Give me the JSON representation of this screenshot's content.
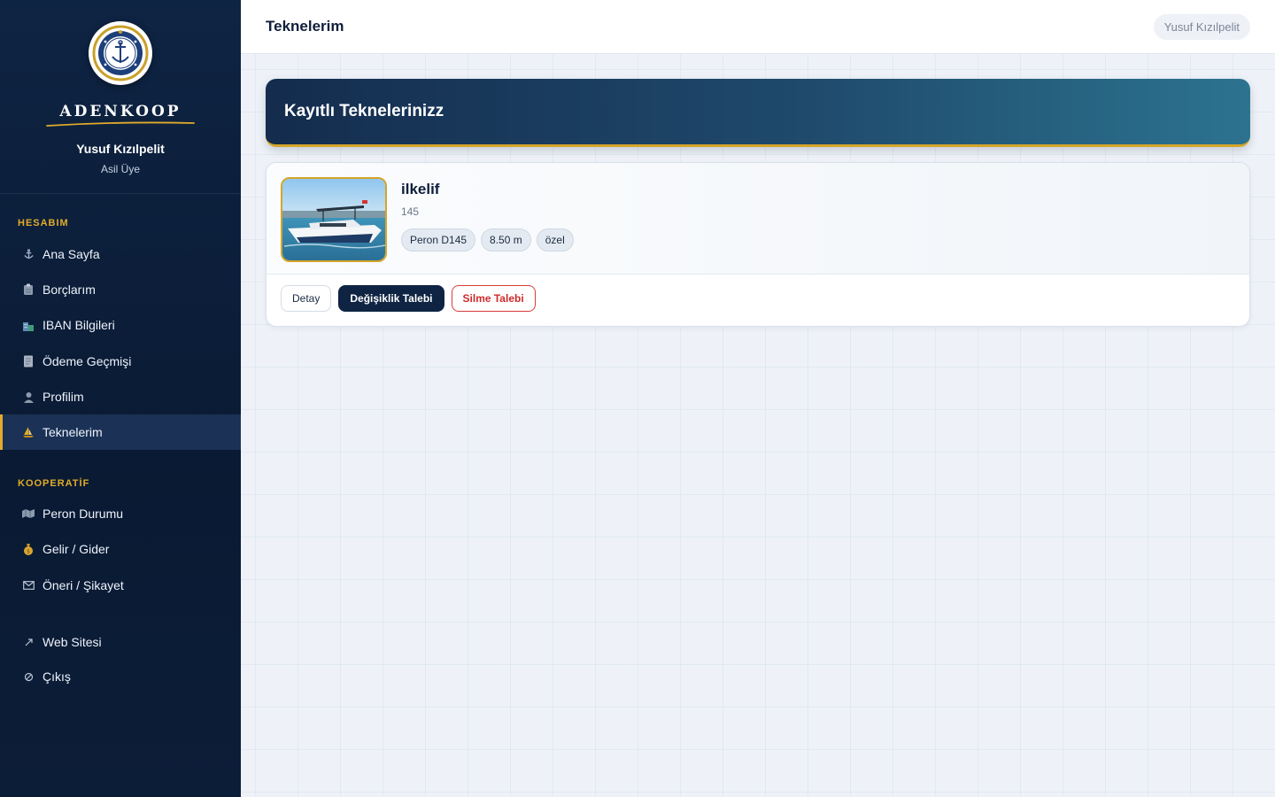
{
  "sidebar": {
    "brand": "ADENKOOP",
    "user_name": "Yusuf Kızılpelit",
    "user_role": "Asil Üye",
    "sections": {
      "hesabim_title": "HESABIM",
      "kooperatif_title": "KOOPERATİF"
    },
    "items": [
      {
        "label": "Ana Sayfa",
        "icon": "anchor-icon"
      },
      {
        "label": "Borçlarım",
        "icon": "clipboard-icon"
      },
      {
        "label": "IBAN Bilgileri",
        "icon": "bank-icon"
      },
      {
        "label": "Ödeme Geçmişi",
        "icon": "receipt-icon"
      },
      {
        "label": "Profilim",
        "icon": "user-icon"
      },
      {
        "label": "Teknelerim",
        "icon": "sailboat-icon",
        "active": true
      },
      {
        "label": "Peron Durumu",
        "icon": "map-icon"
      },
      {
        "label": "Gelir / Gider",
        "icon": "money-bag-icon"
      },
      {
        "label": "Öneri / Şikayet",
        "icon": "mail-icon"
      },
      {
        "label": "Web Sitesi",
        "icon": "external-link-icon"
      },
      {
        "label": "Çıkış",
        "icon": "logout-icon"
      }
    ]
  },
  "header": {
    "title": "Teknelerim",
    "user_chip": "Yusuf Kızılpelit"
  },
  "main": {
    "hero_title": "Kayıtlı Teknelerinizz",
    "boat": {
      "name": "ilkelif",
      "number": "145",
      "tags": [
        "Peron D145",
        "8.50 m",
        "özel"
      ],
      "actions": {
        "detail": "Detay",
        "change": "Değişiklik Talebi",
        "delete": "Silme Talebi"
      }
    }
  },
  "colors": {
    "accent": "#e2ac2a",
    "sidebar_bg": "#0e2443",
    "danger": "#d02a2a"
  }
}
